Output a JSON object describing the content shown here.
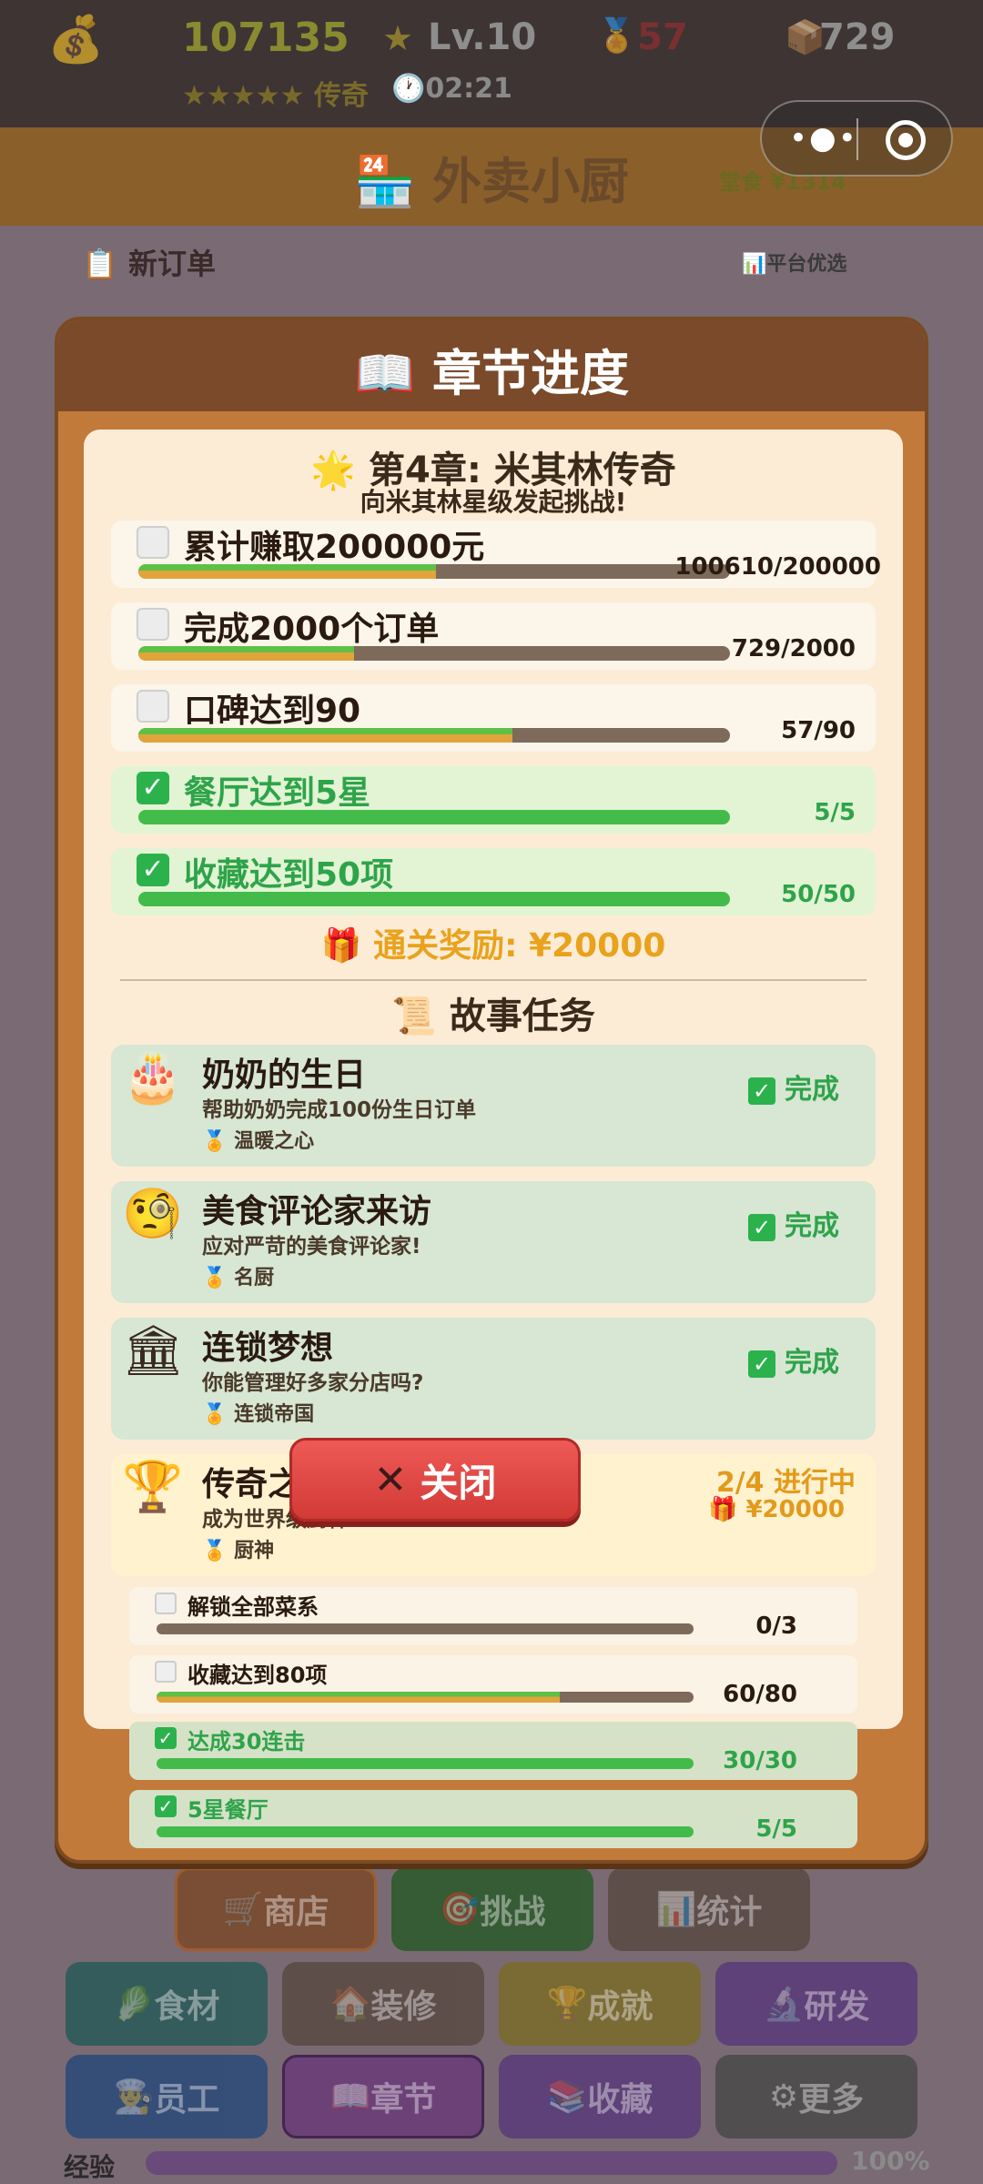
{
  "hud": {
    "money": "107135",
    "level": "Lv.10",
    "medal_count": "57",
    "diamond_count": "729",
    "stars": "★★★★★",
    "rank": "传奇",
    "timer": "02:21"
  },
  "bg": {
    "title": "外卖小厨",
    "cash": "堂食 ¥1314",
    "new_order": "新订单",
    "platform": "平台优选"
  },
  "bottom_buttons": [
    "商店",
    "挑战",
    "统计",
    "食材",
    "装修",
    "成就",
    "研发",
    "员工",
    "章节",
    "收藏",
    "更多"
  ],
  "xp": {
    "label": "经验",
    "value": "100%"
  },
  "modal": {
    "title": "章节进度",
    "chapter_title": "第4章: 米其林传奇",
    "chapter_sub": "向米其林星级发起挑战!",
    "goals": [
      {
        "label": "累计赚取200000元",
        "value": "100610/200000",
        "progress": 0.503,
        "done": false
      },
      {
        "label": "完成2000个订单",
        "value": "729/2000",
        "progress": 0.3645,
        "done": false
      },
      {
        "label": "口碑达到90",
        "value": "57/90",
        "progress": 0.633,
        "done": false
      },
      {
        "label": "餐厅达到5星",
        "value": "5/5",
        "progress": 1.0,
        "done": true
      },
      {
        "label": "收藏达到50项",
        "value": "50/50",
        "progress": 1.0,
        "done": true
      }
    ],
    "reward": "通关奖励: ¥20000",
    "story_title": "故事任务",
    "stories": [
      {
        "icon": "cake-icon",
        "title": "奶奶的生日",
        "desc": "帮助奶奶完成100份生日订单",
        "medal": "温暖之心",
        "status": "完成"
      },
      {
        "icon": "monocle-face-icon",
        "title": "美食评论家来访",
        "desc": "应对严苛的美食评论家!",
        "medal": "名厨",
        "status": "完成"
      },
      {
        "icon": "building-icon",
        "title": "连锁梦想",
        "desc": "你能管理好多家分店吗?",
        "medal": "连锁帝国",
        "status": "完成"
      },
      {
        "icon": "trophy-icon",
        "title": "传奇之路",
        "desc": "成为世界级厨神!",
        "medal": "厨神",
        "status": "2/4 进行中",
        "reward": "¥20000"
      }
    ],
    "subgoals": [
      {
        "label": "解锁全部菜系",
        "value": "0/3",
        "progress": 0.0,
        "done": false
      },
      {
        "label": "收藏达到80项",
        "value": "60/80",
        "progress": 0.75,
        "done": false
      },
      {
        "label": "达成30连击",
        "value": "30/30",
        "progress": 1.0,
        "done": true
      },
      {
        "label": "5星餐厅",
        "value": "5/5",
        "progress": 1.0,
        "done": true
      }
    ],
    "close": "关闭"
  }
}
